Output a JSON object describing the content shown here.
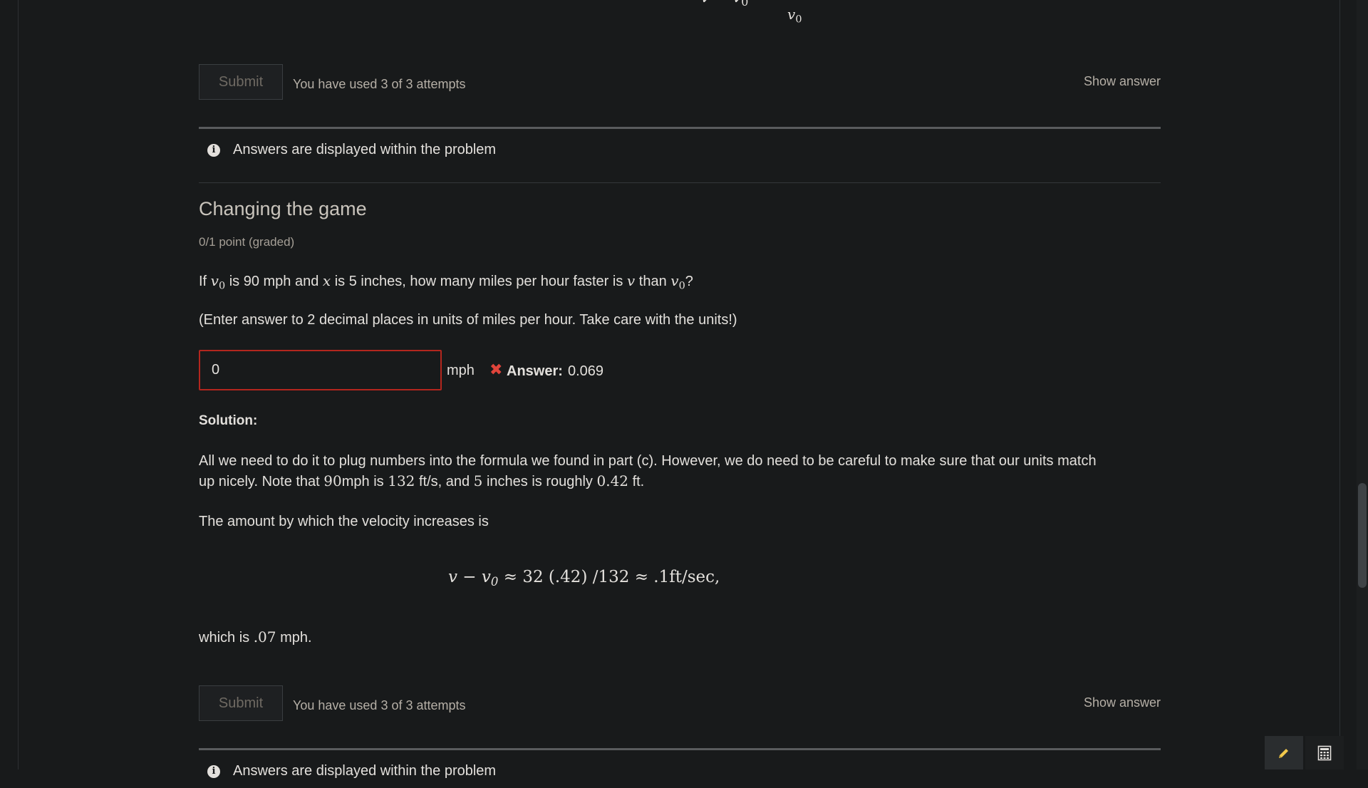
{
  "top_section": {
    "partial_equation": "v − v",
    "partial_equation_sub": "0",
    "partial_equation_rel": "≈",
    "partial_denominator": "v",
    "partial_denominator_sub": "0",
    "submit_label": "Submit",
    "attempts_text": "You have used 3 of 3 attempts",
    "show_answer_label": "Show answer",
    "notice_text": "Answers are displayed within the problem"
  },
  "problem": {
    "title": "Changing the game",
    "points": "0/1 point (graded)",
    "question": {
      "p1": "If ",
      "v0": "v",
      "v0_sub": "0",
      "p2": " is 90 mph and ",
      "x": "x",
      "p3": " is 5 inches, how many miles per hour faster is ",
      "v": "v",
      "p4": " than ",
      "v0b": "v",
      "v0b_sub": "0",
      "p5": "?"
    },
    "instructions": "(Enter answer to 2 decimal places in units of miles per hour. Take care with the units!)",
    "input_value": "0",
    "unit": "mph",
    "status_icon": "✖",
    "answer_label": "Answer:",
    "answer_value": "0.069",
    "solution_label": "Solution:",
    "solution_p1_line1": "All we need to do it to plug numbers into the formula we found in part (c). However, we do need to be careful to make sure that our units match",
    "solution_p1_line2": {
      "a": "up nicely. Note that ",
      "m1": "90",
      "b": "mph is ",
      "m2": "132",
      "c": " ft/s, and ",
      "m3": "5",
      "d": " inches is roughly ",
      "m4": "0.42",
      "e": " ft."
    },
    "solution_p2": "The amount by which the velocity increases is",
    "display_equation": {
      "lhs": "v − v",
      "lhs_sub": "0",
      "rhs": " ≈ 32 (.42) /132 ≈ .1ft/sec,"
    },
    "solution_p3": {
      "a": "which is ",
      "m": ".07",
      "b": " mph."
    },
    "submit_label": "Submit",
    "attempts_text": "You have used 3 of 3 attempts",
    "show_answer_label": "Show answer",
    "notice_text": "Answers are displayed within the problem"
  },
  "icons": {
    "info": "i",
    "pencil": "pencil-icon",
    "calculator": "calculator-icon"
  },
  "colors": {
    "background": "#181a1b",
    "error_border": "#b3261e",
    "error_icon": "#e0443b",
    "pencil_accent": "#f2c94c"
  }
}
